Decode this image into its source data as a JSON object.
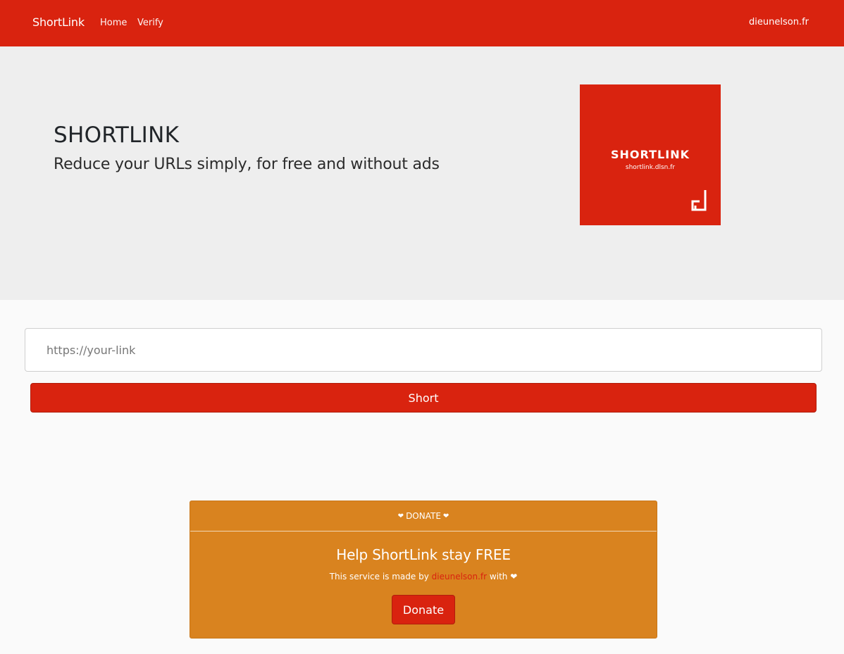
{
  "navbar": {
    "brand": "ShortLink",
    "links": [
      "Home",
      "Verify"
    ],
    "right_link": "dieunelson.fr",
    "color": "#d9230f"
  },
  "hero": {
    "title": "SHORTLINK",
    "subtitle": "Reduce your URLs simply, for free and without ads",
    "logo": {
      "title": "SHORTLINK",
      "subtitle": "shortlink.dlsn.fr",
      "mark_icon": "d-bracket-logo-icon"
    }
  },
  "form": {
    "url_placeholder": "https://your-link",
    "url_value": "",
    "submit_label": "Short"
  },
  "donate": {
    "header_label": "DONATE",
    "heart_icon": "❤",
    "title": "Help ShortLink stay FREE",
    "text_before": "This service is made by",
    "text_link": "dieunelson.fr",
    "text_after": "with",
    "button_label": "Donate",
    "card_color": "#d9831f"
  }
}
